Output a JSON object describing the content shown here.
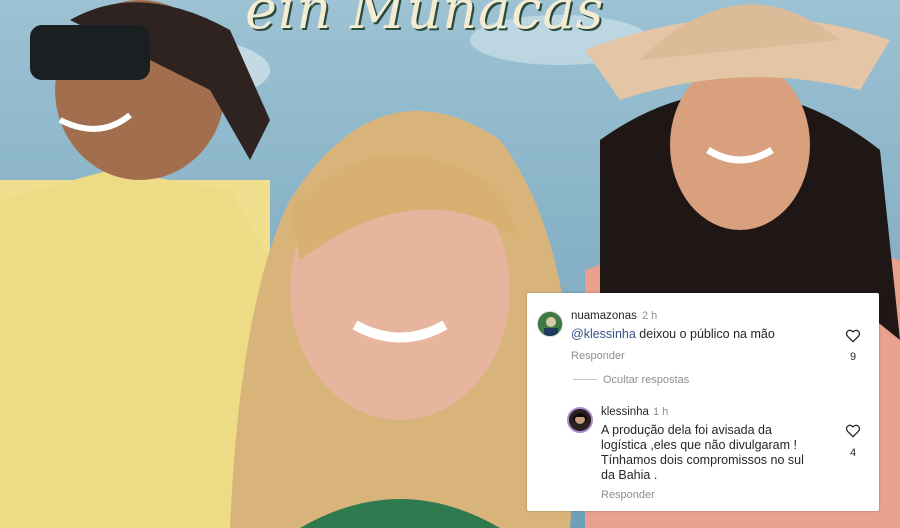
{
  "poster": {
    "title_fragment": "ein Munacas"
  },
  "comments": [
    {
      "username": "nuamazonas",
      "time": "2 h",
      "mention": "@klessinha",
      "text": " deixou o público na mão",
      "reply_label": "Responder",
      "likes": "9"
    },
    {
      "username": "klessinha",
      "time": "1 h",
      "text_lines": [
        "A produção dela foi avisada da",
        "logística ,eles que não divulgaram !",
        "Tínhamos dois compromissos no sul",
        "da Bahia ."
      ],
      "reply_label": "Responder",
      "likes": "4"
    }
  ],
  "hide_replies_label": "Ocultar respostas",
  "colors": {
    "panel_bg": "#ffffff",
    "mention": "#385185",
    "muted": "#8e8e8e"
  }
}
